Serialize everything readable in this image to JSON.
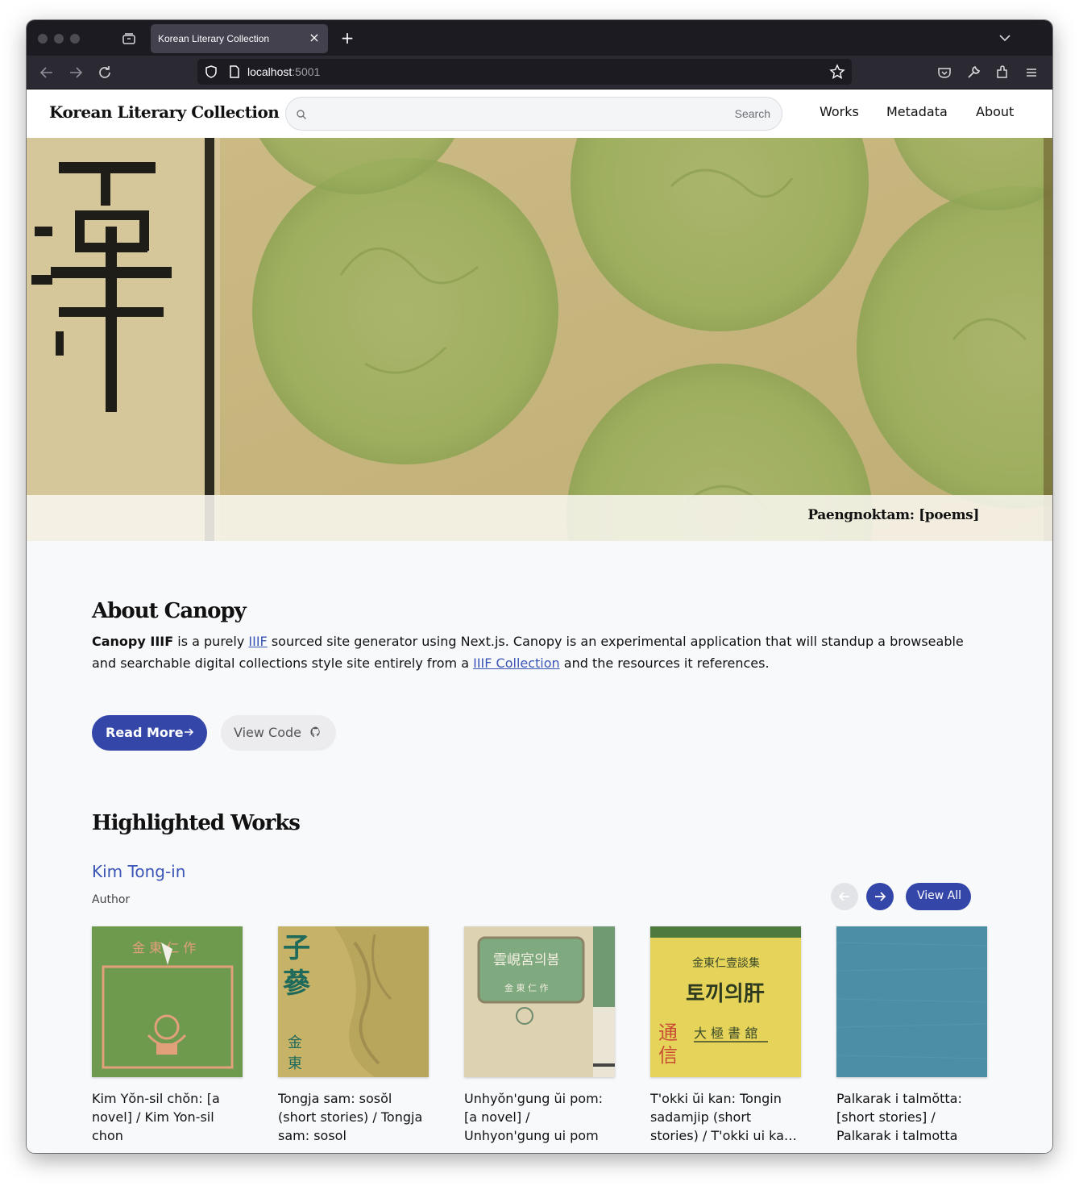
{
  "browser": {
    "tab_title": "Korean Literary Collection",
    "url_host": "localhost",
    "url_port": ":5001"
  },
  "site": {
    "title": "Korean Literary Collection",
    "search_label": "Search",
    "nav": [
      "Works",
      "Metadata",
      "About"
    ]
  },
  "hero": {
    "caption": "Paengnoktam: [poems]"
  },
  "about": {
    "heading": "About Canopy",
    "strong": "Canopy IIIF",
    "text_1": " is a purely ",
    "link_1": "IIIF",
    "text_2": " sourced site generator using Next.js. Canopy is an experimental application that will standup a browseable and searchable digital collections style site entirely from a ",
    "link_2": "IIIF Collection",
    "text_3": " and the resources it references.",
    "read_more": "Read More",
    "view_code": "View Code"
  },
  "highlighted": {
    "heading": "Highlighted Works",
    "author": "Kim Tong-in",
    "author_sub": "Author",
    "view_all": "View All",
    "works": [
      {
        "title": "Kim Yŏn-sil chŏn: [a novel] / Kim Yon-sil chon",
        "cover": "green-cover"
      },
      {
        "title": "Tongja sam: sosŏl (short stories) / Tongja sam: sosol",
        "cover": "ginseng-cover"
      },
      {
        "title": "Unhyŏn'gung ŭi pom: [a novel] / Unhyon'gung ui pom",
        "cover": "framed-cover"
      },
      {
        "title": "T'okki ŭi kan: Tongin sadamjip (short stories) / T'okki ui kan: Tongin sadamjip",
        "cover": "yellow-cover"
      },
      {
        "title": "Palkarak i talmŏtta: [short stories] / Palkarak i talmotta",
        "cover": "blue-cloth-cover"
      }
    ]
  },
  "colors": {
    "accent": "#3446a8",
    "link": "#3a55b5"
  }
}
